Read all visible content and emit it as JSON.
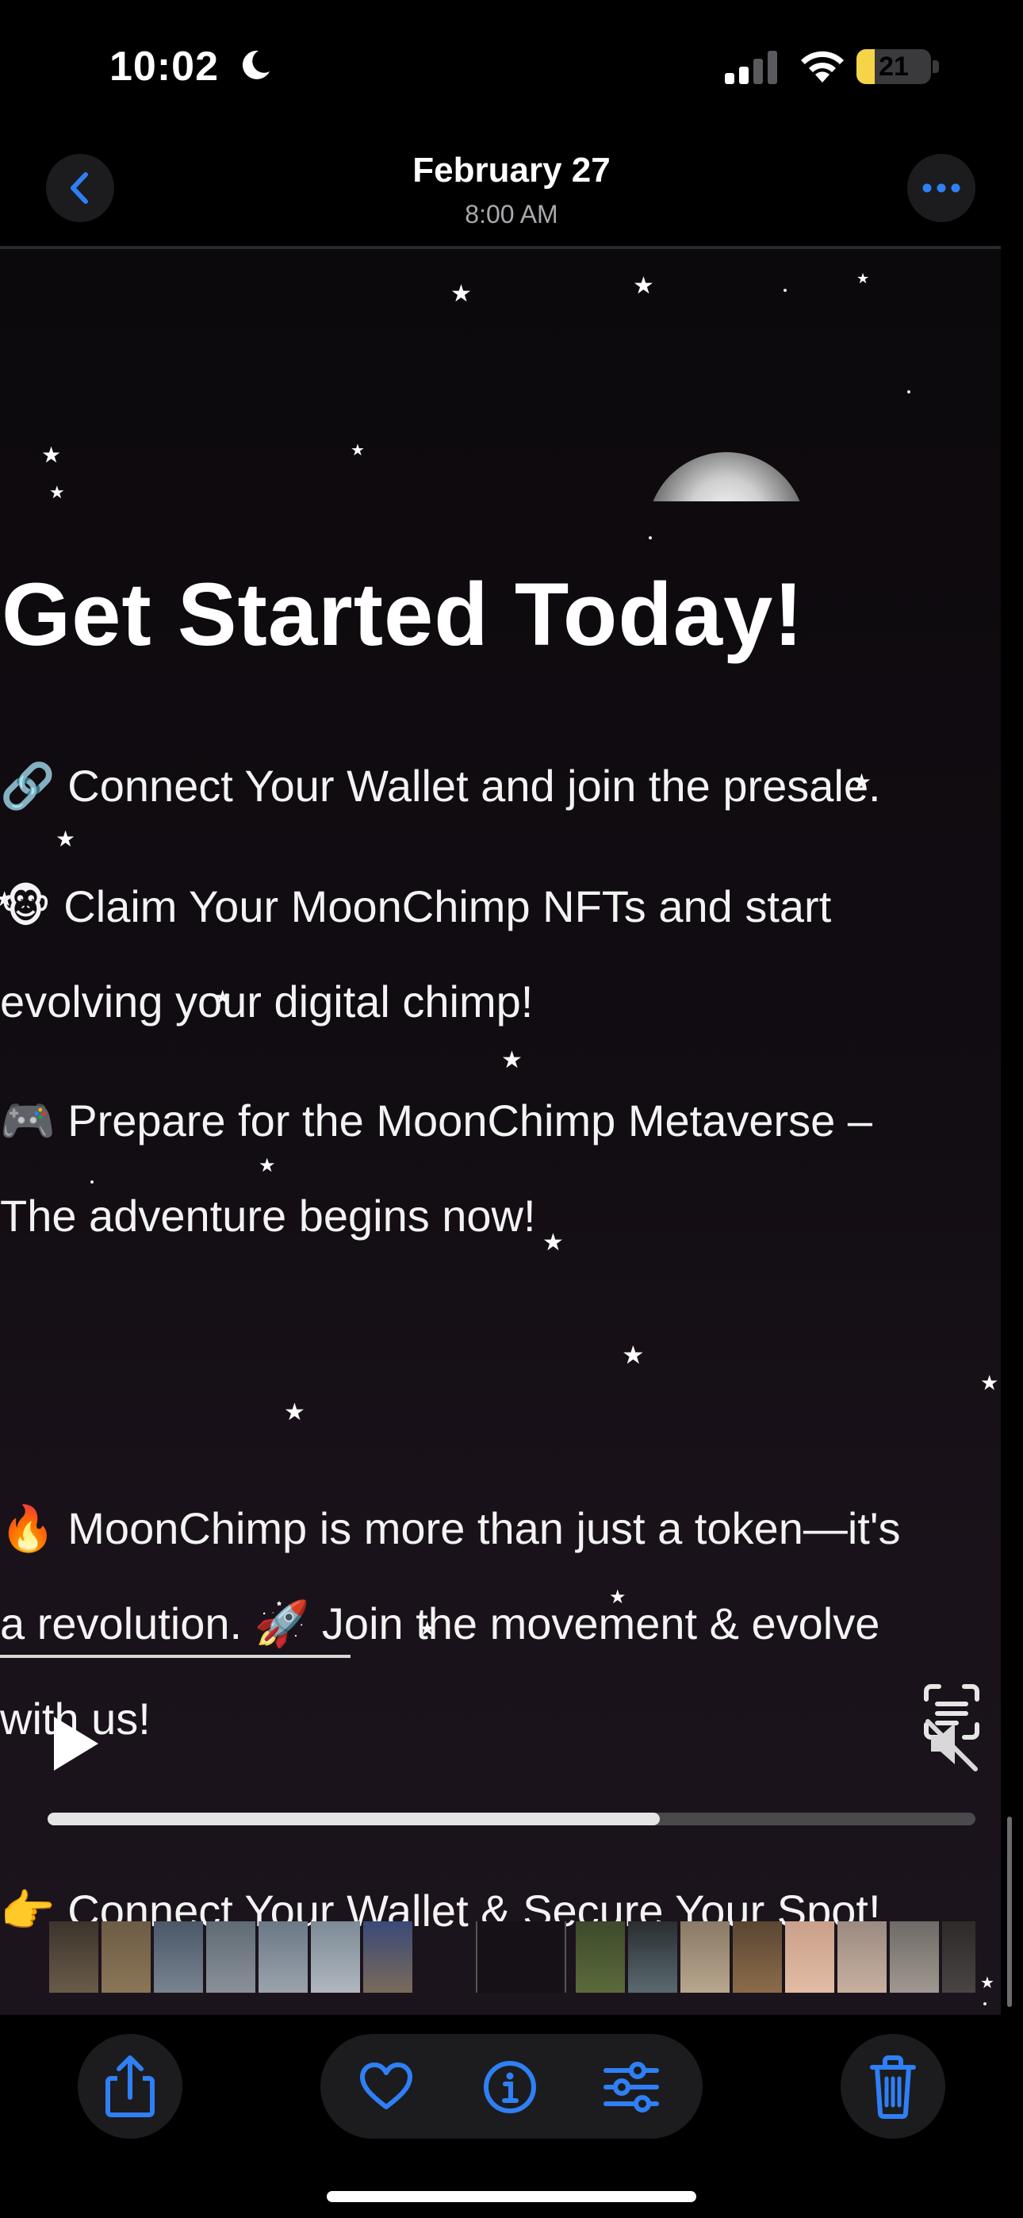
{
  "status_bar": {
    "time": "10:02",
    "battery_level": "21",
    "icons": [
      "moon-icon",
      "signal-icon",
      "wifi-icon",
      "battery-icon"
    ]
  },
  "header": {
    "title": "February 27",
    "subtitle": "8:00 AM"
  },
  "video": {
    "headline": "Get Started Today!",
    "lines": [
      "🔗 Connect Your Wallet and join the presale.",
      "🐵 Claim Your MoonChimp NFTs and start",
      "evolving your digital chimp!",
      "🎮 Prepare for the MoonChimp Metaverse –",
      "The adventure begins now!",
      "🔥 MoonChimp is more than just a token—it's",
      "a revolution. 🚀 Join the movement & evolve",
      "with us!",
      "👉 Connect Your Wallet & Secure Your Spot!"
    ],
    "playback_progress": 0.66
  },
  "colors": {
    "accent": "#2f7ff5",
    "background": "#000000",
    "button_bg": "#1c1c1e"
  },
  "toolbar": {
    "icons": [
      "share-icon",
      "heart-icon",
      "info-icon",
      "adjust-icon",
      "trash-icon"
    ]
  }
}
